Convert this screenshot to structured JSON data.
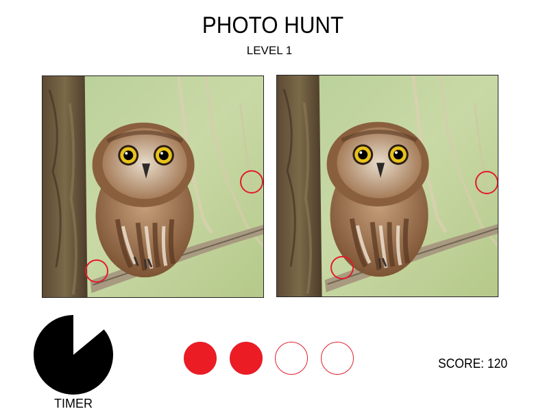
{
  "header": {
    "title": "PHOTO HUNT",
    "level": "LEVEL 1"
  },
  "photos": [
    {
      "name": "original-photo",
      "subject": "owl-on-branch"
    },
    {
      "name": "modified-photo",
      "subject": "owl-on-branch"
    }
  ],
  "found_differences": 2,
  "lives": {
    "total": 4,
    "filled": 2,
    "filled_color": "#ec1c24",
    "outline_color": "#e21b2a"
  },
  "timer": {
    "label": "TIMER",
    "remaining_fraction": 0.86
  },
  "score": {
    "text": "SCORE: 120"
  },
  "colors": {
    "marker": "#e21b2a",
    "timer_fill": "#000000"
  }
}
